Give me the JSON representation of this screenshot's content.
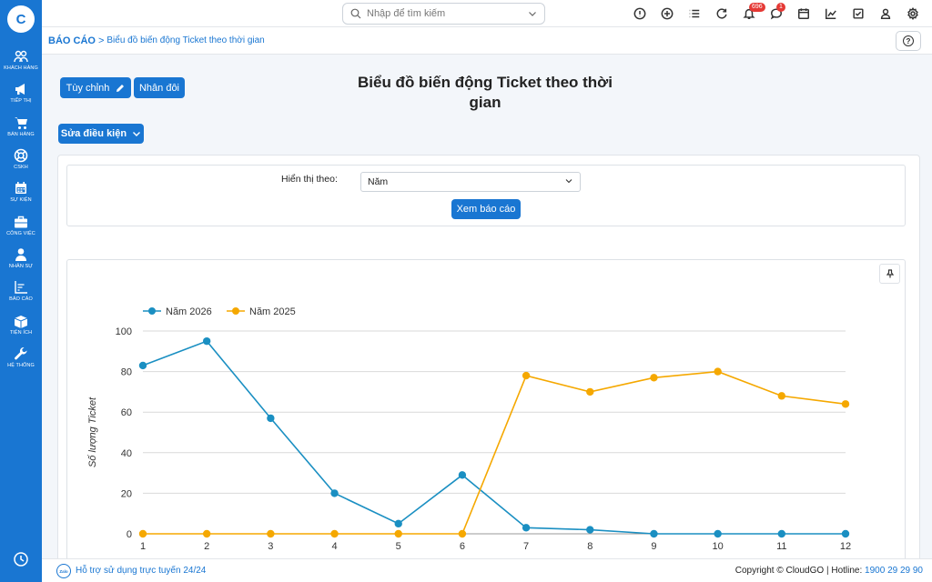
{
  "sidebar": {
    "logo": "C",
    "items": [
      {
        "label": "Khách hàng",
        "icon": "users-icon"
      },
      {
        "label": "Tiếp thị",
        "icon": "megaphone-icon"
      },
      {
        "label": "Bán hàng",
        "icon": "cart-icon"
      },
      {
        "label": "CSKH",
        "icon": "lifebuoy-icon"
      },
      {
        "label": "Sự kiện",
        "icon": "calendar-icon"
      },
      {
        "label": "Công việc",
        "icon": "briefcase-icon"
      },
      {
        "label": "Nhân sự",
        "icon": "person-icon"
      },
      {
        "label": "Báo cáo",
        "icon": "chart-icon"
      },
      {
        "label": "Tiện ích",
        "icon": "box-icon"
      },
      {
        "label": "Hệ thống",
        "icon": "wrench-icon"
      }
    ]
  },
  "topbar": {
    "search_placeholder": "Nhập để tìm kiếm",
    "notification_count": "696",
    "message_count": "1"
  },
  "breadcrumb": {
    "root": "BÁO CÁO",
    "separator": ">",
    "current": "Biểu đồ biến động Ticket theo thời gian"
  },
  "toolbar": {
    "customize_label": "Tùy chỉnh",
    "duplicate_label": "Nhân đôi",
    "edit_conditions_label": "Sửa điều kiện"
  },
  "page": {
    "title": "Biểu đồ biến động Ticket theo thời gian"
  },
  "filter": {
    "label": "Hiển thị theo:",
    "selected": "Năm",
    "view_report_label": "Xem báo cáo"
  },
  "colors": {
    "primary": "#1976d2",
    "series_2026": "#1a8fc2",
    "series_2025": "#f5a800"
  },
  "chart_data": {
    "type": "line",
    "ylabel": "Số lượng Ticket",
    "xlabel": "",
    "x": [
      1,
      2,
      3,
      4,
      5,
      6,
      7,
      8,
      9,
      10,
      11,
      12
    ],
    "ylim": [
      0,
      100
    ],
    "yticks": [
      0,
      20,
      40,
      60,
      80,
      100
    ],
    "grid": true,
    "legend": "top-left",
    "series": [
      {
        "name": "Năm 2026",
        "color": "#1a8fc2",
        "values": [
          83,
          95,
          57,
          20,
          5,
          29,
          3,
          2,
          0,
          0,
          0,
          0
        ]
      },
      {
        "name": "Năm 2025",
        "color": "#f5a800",
        "values": [
          0,
          0,
          0,
          0,
          0,
          0,
          78,
          70,
          77,
          80,
          68,
          64
        ]
      }
    ]
  },
  "footer": {
    "zalo": "Zalo",
    "support": "Hỗ trợ sử dụng trực tuyến 24/24",
    "copyright": "Copyright © CloudGO",
    "hotline_label": "Hotline:",
    "hotline_number": "1900 29 29 90"
  }
}
